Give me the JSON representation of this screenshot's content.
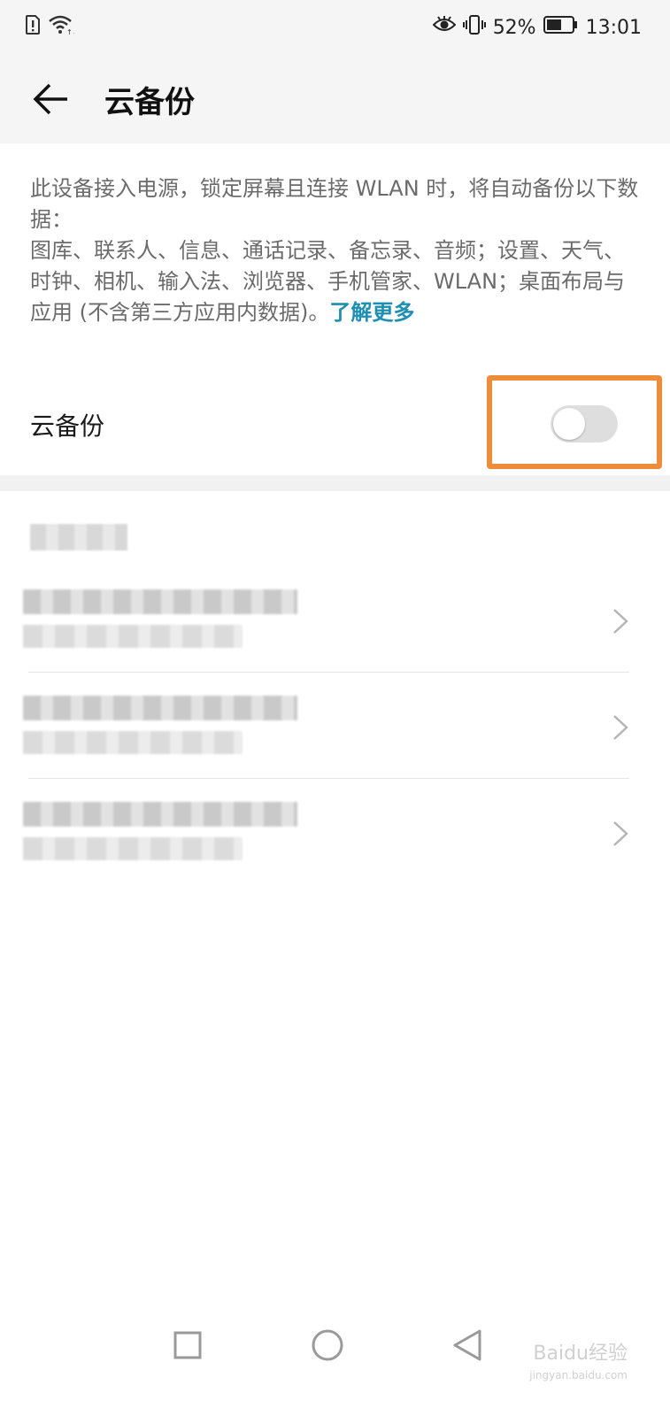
{
  "status_bar": {
    "battery_percent": "52%",
    "time": "13:01",
    "icons": [
      "sim-alert-icon",
      "wifi-icon",
      "eye-icon",
      "vibrate-icon",
      "battery-icon"
    ]
  },
  "app_bar": {
    "title": "云备份",
    "back_icon": "back-arrow-icon"
  },
  "description": {
    "text": "此设备接入电源，锁定屏幕且连接 WLAN 时，将自动备份以下数据：\n图库、联系人、信息、通话记录、备忘录、音频；设置、天气、时钟、相机、输入法、浏览器、手机管家、WLAN；桌面布局与应用 (不含第三方应用内数据)。",
    "link": "了解更多",
    "link_color": "#1d8fb3"
  },
  "toggle": {
    "label": "云备份",
    "state": "off",
    "highlight_color": "#ef8c3a"
  },
  "watermark": {
    "brand": "Baidu经验",
    "url": "jingyan.baidu.com"
  }
}
